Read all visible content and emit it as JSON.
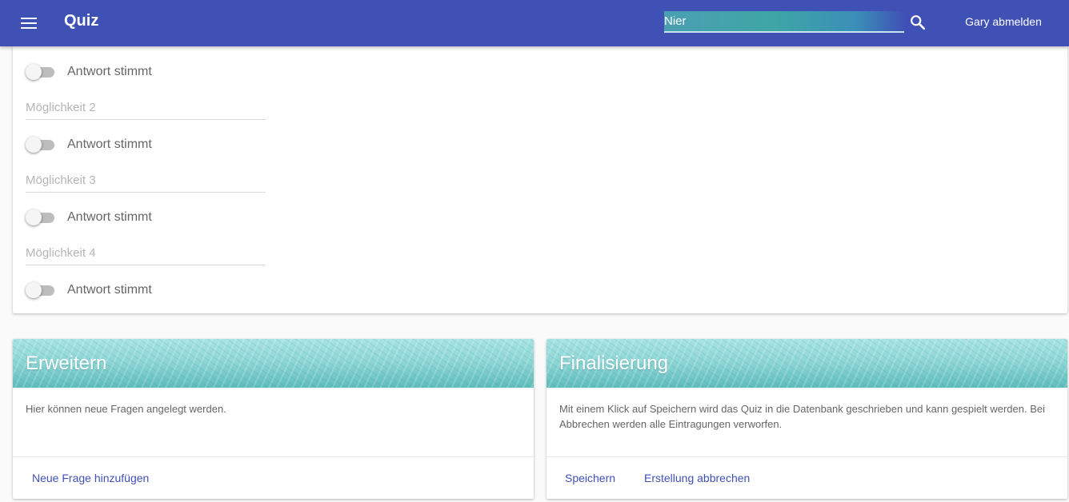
{
  "appbar": {
    "menu_icon": "menu-icon",
    "title": "Quiz",
    "search_value": "Nier",
    "search_icon": "search-icon",
    "logout_label": "Gary abmelden",
    "color": "#3f51b5"
  },
  "question": {
    "options": [
      {
        "placeholder": "",
        "value": "",
        "toggle_label": "Antwort stimmt",
        "correct": false
      },
      {
        "placeholder": "Möglichkeit 2",
        "value": "",
        "toggle_label": "Antwort stimmt",
        "correct": false
      },
      {
        "placeholder": "Möglichkeit 3",
        "value": "",
        "toggle_label": "Antwort stimmt",
        "correct": false
      },
      {
        "placeholder": "Möglichkeit 4",
        "value": "",
        "toggle_label": "Antwort stimmt",
        "correct": false
      }
    ]
  },
  "extend_card": {
    "title": "Erweitern",
    "text": "Hier können neue Fragen angelegt werden.",
    "add_button": "Neue Frage hinzufügen"
  },
  "finalize_card": {
    "title": "Finalisierung",
    "text": "Mit einem Klick auf Speichern wird das Quiz in die Datenbank geschrieben und kann gespielt werden. Bei Abbrechen werden alle Eintragungen verworfen.",
    "save_button": "Speichern",
    "cancel_button": "Erstellung abbrechen"
  },
  "colors": {
    "accent": "#3f51b5",
    "card_header": "#8fd6d6"
  }
}
